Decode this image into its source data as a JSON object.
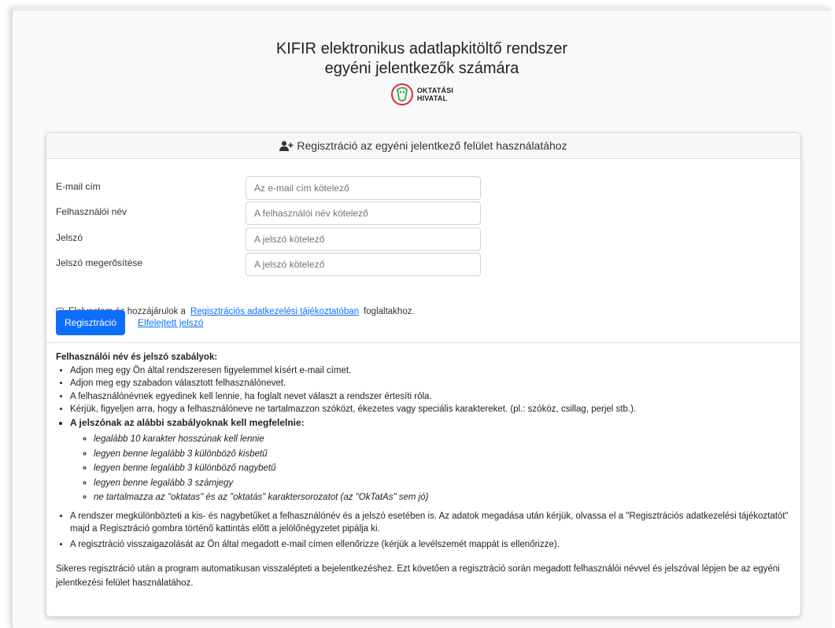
{
  "header": {
    "title_line1": "KIFIR elektronikus adatlapkitöltő rendszer",
    "title_line2": "egyéni jelentkezők számára",
    "logo_line1": "OKTATÁSI",
    "logo_line2": "HIVATAL"
  },
  "card": {
    "header_icon": "user-plus-icon",
    "header_title": "Regisztráció az egyéni jelentkező felület használatához"
  },
  "form": {
    "email_label": "E-mail cím",
    "email_placeholder": "Az e-mail cím kötelező",
    "username_label": "Felhasználói név",
    "username_placeholder": "A felhasználói név kötelező",
    "password_label": "Jelszó",
    "password_placeholder": "A jelszó kötelező",
    "password_confirm_label": "Jelszó megerősítése",
    "password_confirm_placeholder": "A jelszó kötelező",
    "consent_prefix": "Elolvastam és hozzájárulok a",
    "consent_link": "Regisztrációs adatkezelési tájékoztatóban",
    "consent_suffix": "foglaltakhoz.",
    "consent_checked": false,
    "register_button": "Regisztráció",
    "forgot_link": "Elfelejtett jelszó"
  },
  "rules": {
    "title": "Felhasználói név és jelszó szabályok:",
    "items": [
      "Adjon meg egy Ön által rendszeresen figyelemmel kísért e-mail címet.",
      "Adjon meg egy szabadon választott felhasználónevet.",
      "A felhasználónévnek egyedinek kell lennie, ha foglalt nevet választ a rendszer értesíti róla.",
      "Kérjük, figyeljen arra, hogy a felhasználóneve ne tartalmazzon szóközt, ékezetes vagy speciális karaktereket. (pl.: szóköz, csillag, perjel stb.)."
    ],
    "password_rules_title": "A jelszónak az alábbi szabályoknak kell megfelelnie:",
    "password_rules": [
      "legalább 10 karakter hosszúnak kell lennie",
      "legyen benne legalább 3 különböző kisbetű",
      "legyen benne legalább 3 különböző nagybetű",
      "legyen benne legalább 3 számjegy",
      "ne tartalmazza az \"oktatas\" és az \"oktatás\" karaktersorozatot (az \"OkTatAs\" sem jó)"
    ],
    "items_after": [
      "A rendszer megkülönbözteti a kis- és nagybetűket a felhasználónév és a jelszó esetében is. Az adatok megadása után kérjük, olvassa el a \"Regisztrációs adatkezelési tájékoztatót\" majd a Regisztráció gombra történő kattintás előtt a jelölőnégyzetet pipálja ki.",
      "A regisztráció visszaigazolását az Ön által megadott e-mail címen ellenőrizze (kérjük a levélszemét mappát is ellenőrizze)."
    ],
    "footer": "Sikeres regisztráció után a program automatikusan visszalépteti a bejelentkezéshez. Ezt követően a regisztráció során megadott felhasználói névvel és jelszóval lépjen be az egyéni jelentkezési felület használatához."
  },
  "colors": {
    "primary": "#0d6efd",
    "logo_red": "#e5283a",
    "logo_green": "#3aa54b"
  }
}
